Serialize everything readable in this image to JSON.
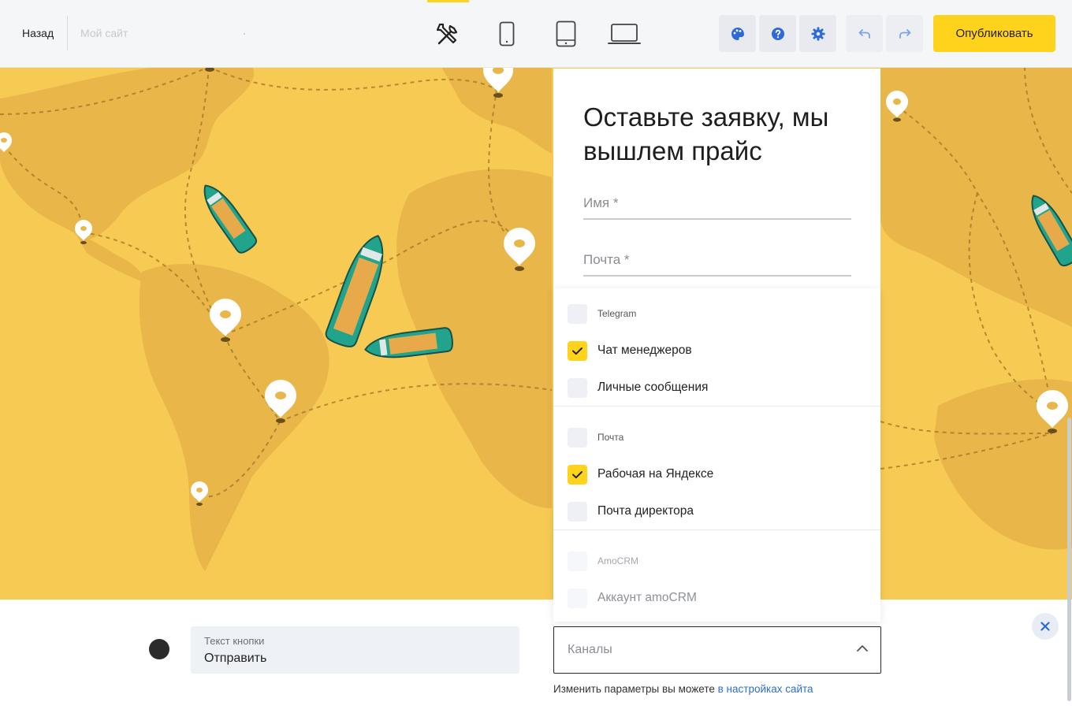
{
  "header": {
    "back_label": "Назад",
    "site_placeholder": "Мой сайт",
    "devices": [
      {
        "name": "tools",
        "icon": "tools-icon",
        "active": true
      },
      {
        "name": "mobile",
        "icon": "smartphone-icon"
      },
      {
        "name": "tablet",
        "icon": "tablet-icon"
      },
      {
        "name": "desktop",
        "icon": "laptop-icon"
      }
    ],
    "buttons": [
      {
        "name": "palette",
        "icon": "palette-icon"
      },
      {
        "name": "help",
        "icon": "help-icon"
      },
      {
        "name": "settings",
        "icon": "gear-icon"
      },
      {
        "name": "undo",
        "icon": "undo-icon"
      },
      {
        "name": "redo",
        "icon": "redo-icon"
      }
    ],
    "publish_label": "Опубликовать",
    "accent_color": "#ffd21c",
    "icon_color": "#2d6ad9"
  },
  "form": {
    "title": "Оставьте заявку, мы вышлем прайс",
    "name_placeholder": "Имя *",
    "email_placeholder": "Почта *"
  },
  "channels_dropdown": {
    "groups": [
      {
        "label": "Telegram",
        "options": [
          {
            "label": "Чат менеджеров",
            "checked": true
          },
          {
            "label": "Личные сообщения",
            "checked": false
          }
        ]
      },
      {
        "label": "Почта",
        "options": [
          {
            "label": "Рабочая на Яндексе",
            "checked": true
          },
          {
            "label": "Почта директора",
            "checked": false
          }
        ]
      },
      {
        "label": "AmoCRM",
        "disabled": true,
        "options": [
          {
            "label": "Аккаунт amoCRM",
            "checked": false
          }
        ]
      }
    ]
  },
  "bottom_panel": {
    "button_color": "#2b2b2b",
    "button_text_label": "Текст кнопки",
    "button_text_value": "Отправить",
    "channels_placeholder": "Каналы",
    "hint_text": "Изменить параметры вы можете ",
    "hint_link": "в настройках сайта"
  },
  "map": {
    "background_color": "#f7cb53",
    "land_color": "#e9b64a",
    "icon": "world-map-illustration"
  }
}
